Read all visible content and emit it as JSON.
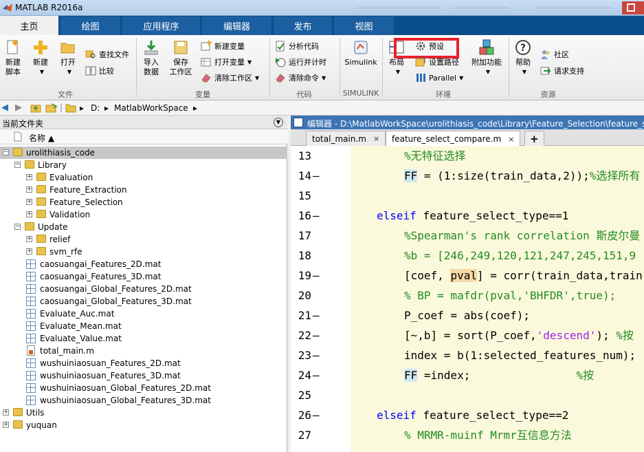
{
  "window": {
    "title": "MATLAB R2016a"
  },
  "ribbon_tabs": [
    "主页",
    "绘图",
    "应用程序",
    "编辑器",
    "发布",
    "视图"
  ],
  "ribbon": {
    "file": {
      "new_script": "新建\n脚本",
      "new": "新建",
      "open": "打开",
      "find_files": "查找文件",
      "compare": "比较",
      "group": "文件"
    },
    "variable": {
      "import": "导入\n数据",
      "save_workspace": "保存\n工作区",
      "new_variable": "新建变量",
      "open_variable": "打开变量",
      "clear_workspace": "清除工作区",
      "group": "变量"
    },
    "code": {
      "analyze": "分析代码",
      "run_time": "运行并计时",
      "clear_commands": "清除命令",
      "group": "代码"
    },
    "simulink": {
      "label": "Simulink",
      "group": "SIMULINK"
    },
    "environment": {
      "layout": "布局",
      "preferences": "预设",
      "set_path": "设置路径",
      "parallel": "Parallel",
      "addons": "附加功能",
      "group": "环境"
    },
    "resources": {
      "help": "帮助",
      "community": "社区",
      "request_support": "请求支持",
      "group": "资源"
    }
  },
  "address": {
    "drive": "D:",
    "folder": "MatlabWorkSpace"
  },
  "file_panel": {
    "title": "当前文件夹",
    "column_name": "名称 ▲",
    "items": [
      {
        "label": "urolithiasis_code",
        "kind": "folder",
        "level": 0,
        "expand": "−",
        "selected": true
      },
      {
        "label": "Library",
        "kind": "folder",
        "level": 1,
        "expand": "−"
      },
      {
        "label": "Evaluation",
        "kind": "folder",
        "level": 2,
        "expand": "+"
      },
      {
        "label": "Feature_Extraction",
        "kind": "folder",
        "level": 2,
        "expand": "+"
      },
      {
        "label": "Feature_Selection",
        "kind": "folder",
        "level": 2,
        "expand": "+"
      },
      {
        "label": "Validation",
        "kind": "folder",
        "level": 2,
        "expand": "+"
      },
      {
        "label": "Update",
        "kind": "folder",
        "level": 1,
        "expand": "−"
      },
      {
        "label": "relief",
        "kind": "folder",
        "level": 2,
        "expand": "+"
      },
      {
        "label": "svm_rfe",
        "kind": "folder",
        "level": 2,
        "expand": "+"
      },
      {
        "label": "caosuangai_Features_2D.mat",
        "kind": "mat",
        "level": 1
      },
      {
        "label": "caosuangai_Features_3D.mat",
        "kind": "mat",
        "level": 1
      },
      {
        "label": "caosuangai_Global_Features_2D.mat",
        "kind": "mat",
        "level": 1
      },
      {
        "label": "caosuangai_Global_Features_3D.mat",
        "kind": "mat",
        "level": 1
      },
      {
        "label": "Evaluate_Auc.mat",
        "kind": "mat",
        "level": 1
      },
      {
        "label": "Evaluate_Mean.mat",
        "kind": "mat",
        "level": 1
      },
      {
        "label": "Evaluate_Value.mat",
        "kind": "mat",
        "level": 1
      },
      {
        "label": "total_main.m",
        "kind": "m",
        "level": 1
      },
      {
        "label": "wushuiniaosuan_Features_2D.mat",
        "kind": "mat",
        "level": 1
      },
      {
        "label": "wushuiniaosuan_Features_3D.mat",
        "kind": "mat",
        "level": 1
      },
      {
        "label": "wushuiniaosuan_Global_Features_2D.mat",
        "kind": "mat",
        "level": 1
      },
      {
        "label": "wushuiniaosuan_Global_Features_3D.mat",
        "kind": "mat",
        "level": 1
      },
      {
        "label": "Utils",
        "kind": "folder",
        "level": 0,
        "expand": "+"
      },
      {
        "label": "yuquan",
        "kind": "folder",
        "level": 0,
        "expand": "+"
      }
    ]
  },
  "editor": {
    "title": "编辑器 - D:\\MatlabWorkSpace\\urolithiasis_code\\Library\\Feature_Selection\\feature_se",
    "tabs": [
      {
        "label": "total_main.m",
        "active": false
      },
      {
        "label": "feature_select_compare.m",
        "active": true
      }
    ],
    "add_tab": "+",
    "lines": [
      {
        "n": "13",
        "dash": false,
        "indent": 2,
        "parts": [
          [
            "cm",
            "%无特征选择"
          ]
        ]
      },
      {
        "n": "14",
        "dash": true,
        "indent": 2,
        "parts": [
          [
            "hl",
            "FF"
          ],
          [
            "",
            " = (1:size(train_data,2));"
          ],
          [
            "cm",
            "%选择所有"
          ]
        ]
      },
      {
        "n": "15",
        "dash": false,
        "indent": 0,
        "parts": []
      },
      {
        "n": "16",
        "dash": true,
        "indent": 1,
        "parts": [
          [
            "kw",
            "elseif"
          ],
          [
            "",
            " feature_select_type==1"
          ]
        ]
      },
      {
        "n": "17",
        "dash": false,
        "indent": 2,
        "parts": [
          [
            "cm",
            "%Spearman's rank correlation 斯皮尔曼"
          ]
        ]
      },
      {
        "n": "18",
        "dash": false,
        "indent": 2,
        "parts": [
          [
            "cm",
            "%b = [246,249,120,121,247,245,151,9"
          ]
        ]
      },
      {
        "n": "19",
        "dash": true,
        "indent": 2,
        "parts": [
          [
            "",
            "[coef, "
          ],
          [
            "hlv",
            "pval"
          ],
          [
            "",
            "] = corr(train_data,train"
          ]
        ]
      },
      {
        "n": "20",
        "dash": false,
        "indent": 2,
        "parts": [
          [
            "cm",
            "% BP = mafdr(pval,'BHFDR',true);"
          ]
        ]
      },
      {
        "n": "21",
        "dash": true,
        "indent": 2,
        "parts": [
          [
            "",
            "P_coef = abs(coef);"
          ]
        ]
      },
      {
        "n": "22",
        "dash": true,
        "indent": 2,
        "parts": [
          [
            "",
            "[~,b] = sort(P_coef,"
          ],
          [
            "st",
            "'descend'"
          ],
          [
            "",
            "); "
          ],
          [
            "cm",
            "%按"
          ]
        ]
      },
      {
        "n": "23",
        "dash": true,
        "indent": 2,
        "parts": [
          [
            "",
            "index = b(1:selected_features_num);"
          ]
        ]
      },
      {
        "n": "24",
        "dash": true,
        "indent": 2,
        "parts": [
          [
            "hl",
            "FF"
          ],
          [
            "",
            " =index;                "
          ],
          [
            "cm",
            "%按"
          ]
        ]
      },
      {
        "n": "25",
        "dash": false,
        "indent": 0,
        "parts": []
      },
      {
        "n": "26",
        "dash": true,
        "indent": 1,
        "parts": [
          [
            "kw",
            "elseif"
          ],
          [
            "",
            " feature_select_type==2"
          ]
        ]
      },
      {
        "n": "27",
        "dash": false,
        "indent": 2,
        "parts": [
          [
            "cm",
            "% MRMR-muinf Mrmr互信息方法"
          ]
        ]
      }
    ]
  }
}
